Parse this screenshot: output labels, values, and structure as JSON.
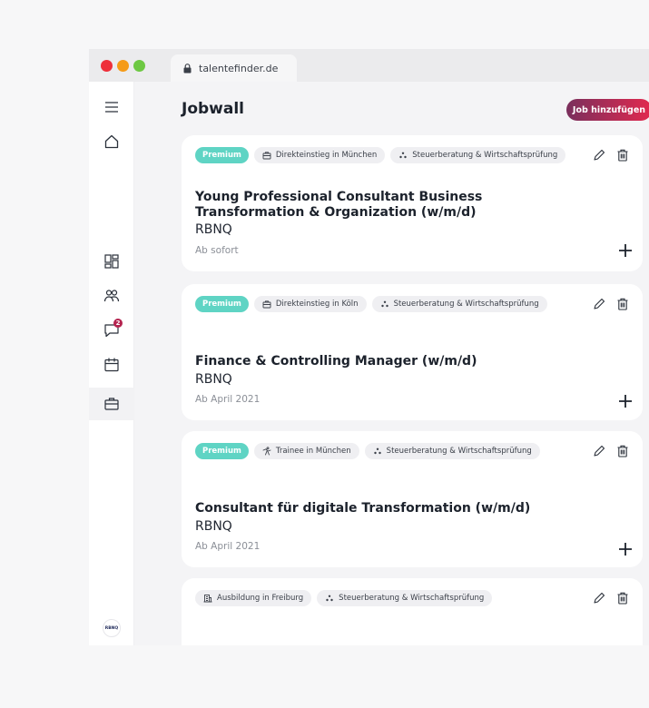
{
  "colors": {
    "premium": "#5fd4c4",
    "accent_start": "#7a2f5c",
    "accent_end": "#e2294f",
    "badge": "#b4234f",
    "dot_red": "#ee2f3a",
    "dot_orange": "#f59b18",
    "dot_green": "#6dc843"
  },
  "browser": {
    "url": "talentefinder.de"
  },
  "sidebar": {
    "items": [
      {
        "icon": "menu-icon"
      },
      {
        "icon": "home-icon"
      },
      {
        "icon": "dashboard-icon"
      },
      {
        "icon": "team-icon"
      },
      {
        "icon": "chat-icon",
        "badge": "2"
      },
      {
        "icon": "calendar-icon"
      },
      {
        "icon": "briefcase-icon",
        "active": true
      }
    ],
    "logo_text": "RBNQ"
  },
  "header": {
    "title": "Jobwall",
    "add_button": "Job hinzufügen"
  },
  "jobs": [
    {
      "premium": "Premium",
      "tags": [
        "Direkteinstieg in München",
        "Steuerberatung & Wirtschaftsprüfung"
      ],
      "title": "Young Professional Consultant Business Transformation & Organization (w/m/d)",
      "company": "RBNQ",
      "start": "Ab sofort"
    },
    {
      "premium": "Premium",
      "tags": [
        "Direkteinstieg in Köln",
        "Steuerberatung & Wirtschaftsprüfung"
      ],
      "title": "Finance & Controlling Manager (w/m/d)",
      "company": "RBNQ",
      "start": "Ab April 2021"
    },
    {
      "premium": "Premium",
      "tags": [
        "Trainee in München",
        "Steuerberatung & Wirtschaftsprüfung"
      ],
      "title": "Consultant für digitale Transformation (w/m/d)",
      "company": "RBNQ",
      "start": "Ab April 2021"
    },
    {
      "tags": [
        "Ausbildung in Freiburg",
        "Steuerberatung & Wirtschaftsprüfung"
      ]
    }
  ]
}
